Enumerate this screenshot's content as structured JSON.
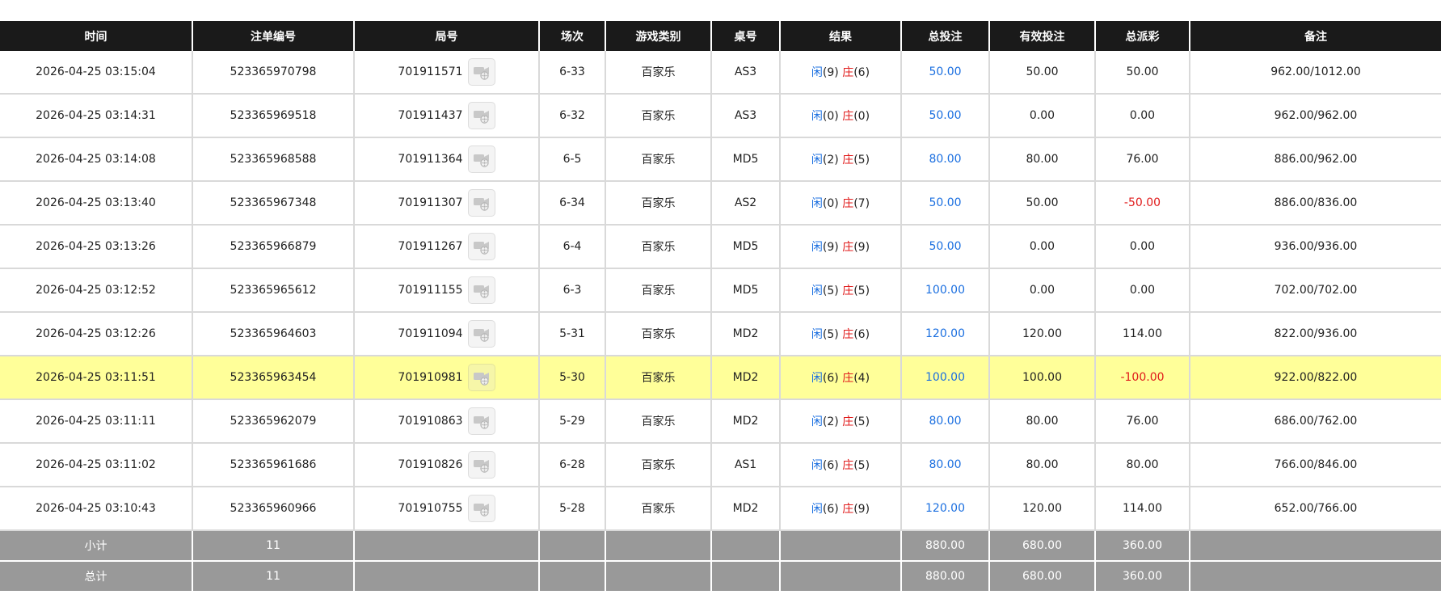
{
  "columns": [
    "时间",
    "注单编号",
    "局号",
    "场次",
    "游戏类别",
    "桌号",
    "结果",
    "总投注",
    "有效投注",
    "总派彩",
    "备注"
  ],
  "colors": {
    "player": "#1b6fe0",
    "banker": "#e01b1b",
    "bet": "#1b6fe0",
    "negative": "#e01b1b",
    "highlight": "#ffff99"
  },
  "result_labels": {
    "player": "闲",
    "banker": "庄"
  },
  "rows": [
    {
      "time": "2026-04-25 03:15:04",
      "order_no": "523365970798",
      "round_no": "701911571",
      "session": "6-33",
      "game": "百家乐",
      "table": "AS3",
      "player_score": "(9)",
      "banker_score": "(6)",
      "total_bet": "50.00",
      "valid_bet": "50.00",
      "payout": "50.00",
      "payout_negative": false,
      "note": "962.00/1012.00",
      "highlighted": false
    },
    {
      "time": "2026-04-25 03:14:31",
      "order_no": "523365969518",
      "round_no": "701911437",
      "session": "6-32",
      "game": "百家乐",
      "table": "AS3",
      "player_score": "(0)",
      "banker_score": "(0)",
      "total_bet": "50.00",
      "valid_bet": "0.00",
      "payout": "0.00",
      "payout_negative": false,
      "note": "962.00/962.00",
      "highlighted": false
    },
    {
      "time": "2026-04-25 03:14:08",
      "order_no": "523365968588",
      "round_no": "701911364",
      "session": "6-5",
      "game": "百家乐",
      "table": "MD5",
      "player_score": "(2)",
      "banker_score": "(5)",
      "total_bet": "80.00",
      "valid_bet": "80.00",
      "payout": "76.00",
      "payout_negative": false,
      "note": "886.00/962.00",
      "highlighted": false
    },
    {
      "time": "2026-04-25 03:13:40",
      "order_no": "523365967348",
      "round_no": "701911307",
      "session": "6-34",
      "game": "百家乐",
      "table": "AS2",
      "player_score": "(0)",
      "banker_score": "(7)",
      "total_bet": "50.00",
      "valid_bet": "50.00",
      "payout": "-50.00",
      "payout_negative": true,
      "note": "886.00/836.00",
      "highlighted": false
    },
    {
      "time": "2026-04-25 03:13:26",
      "order_no": "523365966879",
      "round_no": "701911267",
      "session": "6-4",
      "game": "百家乐",
      "table": "MD5",
      "player_score": "(9)",
      "banker_score": "(9)",
      "total_bet": "50.00",
      "valid_bet": "0.00",
      "payout": "0.00",
      "payout_negative": false,
      "note": "936.00/936.00",
      "highlighted": false
    },
    {
      "time": "2026-04-25 03:12:52",
      "order_no": "523365965612",
      "round_no": "701911155",
      "session": "6-3",
      "game": "百家乐",
      "table": "MD5",
      "player_score": "(5)",
      "banker_score": "(5)",
      "total_bet": "100.00",
      "valid_bet": "0.00",
      "payout": "0.00",
      "payout_negative": false,
      "note": "702.00/702.00",
      "highlighted": false
    },
    {
      "time": "2026-04-25 03:12:26",
      "order_no": "523365964603",
      "round_no": "701911094",
      "session": "5-31",
      "game": "百家乐",
      "table": "MD2",
      "player_score": "(5)",
      "banker_score": "(6)",
      "total_bet": "120.00",
      "valid_bet": "120.00",
      "payout": "114.00",
      "payout_negative": false,
      "note": "822.00/936.00",
      "highlighted": false
    },
    {
      "time": "2026-04-25 03:11:51",
      "order_no": "523365963454",
      "round_no": "701910981",
      "session": "5-30",
      "game": "百家乐",
      "table": "MD2",
      "player_score": "(6)",
      "banker_score": "(4)",
      "total_bet": "100.00",
      "valid_bet": "100.00",
      "payout": "-100.00",
      "payout_negative": true,
      "note": "922.00/822.00",
      "highlighted": true
    },
    {
      "time": "2026-04-25 03:11:11",
      "order_no": "523365962079",
      "round_no": "701910863",
      "session": "5-29",
      "game": "百家乐",
      "table": "MD2",
      "player_score": "(2)",
      "banker_score": "(5)",
      "total_bet": "80.00",
      "valid_bet": "80.00",
      "payout": "76.00",
      "payout_negative": false,
      "note": "686.00/762.00",
      "highlighted": false
    },
    {
      "time": "2026-04-25 03:11:02",
      "order_no": "523365961686",
      "round_no": "701910826",
      "session": "6-28",
      "game": "百家乐",
      "table": "AS1",
      "player_score": "(6)",
      "banker_score": "(5)",
      "total_bet": "80.00",
      "valid_bet": "80.00",
      "payout": "80.00",
      "payout_negative": false,
      "note": "766.00/846.00",
      "highlighted": false
    },
    {
      "time": "2026-04-25 03:10:43",
      "order_no": "523365960966",
      "round_no": "701910755",
      "session": "5-28",
      "game": "百家乐",
      "table": "MD2",
      "player_score": "(6)",
      "banker_score": "(9)",
      "total_bet": "120.00",
      "valid_bet": "120.00",
      "payout": "114.00",
      "payout_negative": false,
      "note": "652.00/766.00",
      "highlighted": false
    }
  ],
  "subtotal": {
    "label": "小计",
    "count": "11",
    "total_bet": "880.00",
    "valid_bet": "680.00",
    "payout": "360.00"
  },
  "grand_total": {
    "label": "总计",
    "count": "11",
    "total_bet": "880.00",
    "valid_bet": "680.00",
    "payout": "360.00"
  }
}
